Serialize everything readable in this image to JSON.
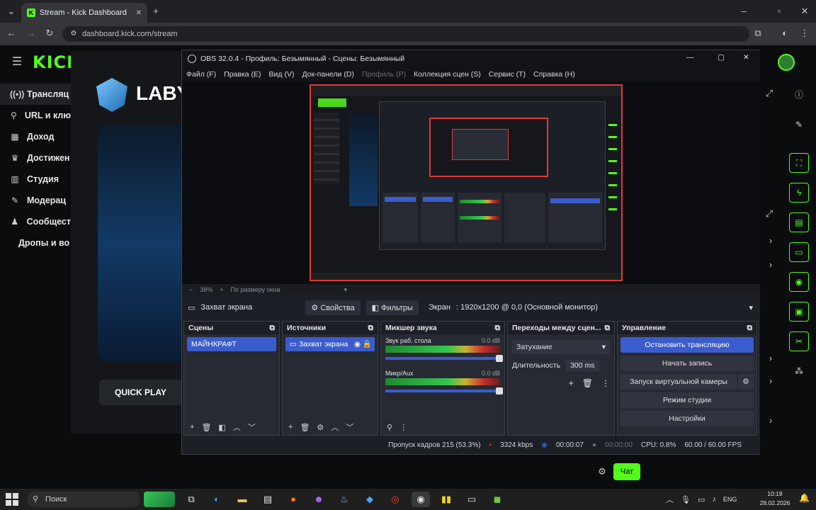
{
  "browser": {
    "tab_title": "Stream - Kick Dashboard",
    "url": "dashboard.kick.com/stream"
  },
  "kick": {
    "logo": "KICK",
    "nav": [
      {
        "icon": "broadcast-icon",
        "label": "Трансляц"
      },
      {
        "icon": "link-icon",
        "label": "URL и клю"
      },
      {
        "icon": "dollar-icon",
        "label": "Доход"
      },
      {
        "icon": "trophy-icon",
        "label": "Достижен"
      },
      {
        "icon": "film-icon",
        "label": "Студия"
      },
      {
        "icon": "wrench-icon",
        "label": "Модерац"
      },
      {
        "icon": "people-icon",
        "label": "Сообщест"
      },
      {
        "icon": "",
        "label": "Дропы и во"
      }
    ],
    "game_logo_text": "LABY",
    "quick_play": "QUICK PLAY",
    "chat_button": "Чат"
  },
  "obs": {
    "title": "OBS 32.0.4 - Профиль: Безымянный - Сцены: Безымянный",
    "menu": [
      {
        "label": "Файл (F)",
        "disabled": false
      },
      {
        "label": "Правка (E)",
        "disabled": false
      },
      {
        "label": "Вид (V)",
        "disabled": false
      },
      {
        "label": "Док-панели (D)",
        "disabled": false
      },
      {
        "label": "Профиль (P)",
        "disabled": true
      },
      {
        "label": "Коллекция сцен (S)",
        "disabled": false
      },
      {
        "label": "Сервис (T)",
        "disabled": false
      },
      {
        "label": "Справка (H)",
        "disabled": false
      }
    ],
    "zoom": {
      "value": "38%",
      "mode": "По размеру окна"
    },
    "source_bar": {
      "source_name": "Захват экрана",
      "properties": "Свойства",
      "filters": "Фильтры",
      "screen_label": "Экран",
      "screen_value": ": 1920x1200 @ 0,0 (Основной монитор)"
    },
    "scenes": {
      "header": "Сцены",
      "items": [
        "МАЙНКРАФТ"
      ]
    },
    "sources": {
      "header": "Источники",
      "items": [
        "Захват экрана"
      ]
    },
    "mixer": {
      "header": "Микшер звука",
      "channels": [
        {
          "name": "Звук раб. стола",
          "db": "0.0 dB"
        },
        {
          "name": "Микр/Aux",
          "db": "0.0 dB"
        }
      ]
    },
    "transitions": {
      "header": "Переходы между сцен...",
      "type": "Затухание",
      "duration_label": "Длительность",
      "duration_value": "300 ms"
    },
    "controls": {
      "header": "Управление",
      "buttons": [
        "Остановить трансляцию",
        "Начать запись",
        "Запуск виртуальной камеры",
        "Режим студии",
        "Настройки"
      ]
    },
    "status": {
      "dropped": "Пропуск кадров 215 (53.3%)",
      "bitrate": "3324 kbps",
      "stream_time": "00:00:07",
      "rec_time": "00:00:00",
      "cpu": "CPU: 0.8%",
      "fps": "60.00 / 60.00 FPS"
    }
  },
  "taskbar": {
    "search": "Поиск",
    "lang": "ENG",
    "time": "10:18",
    "date": "28.02.2026"
  },
  "colors": {
    "kick_green": "#53fc18",
    "obs_blue": "#3b5ccc",
    "border_red": "#e03a3a"
  }
}
